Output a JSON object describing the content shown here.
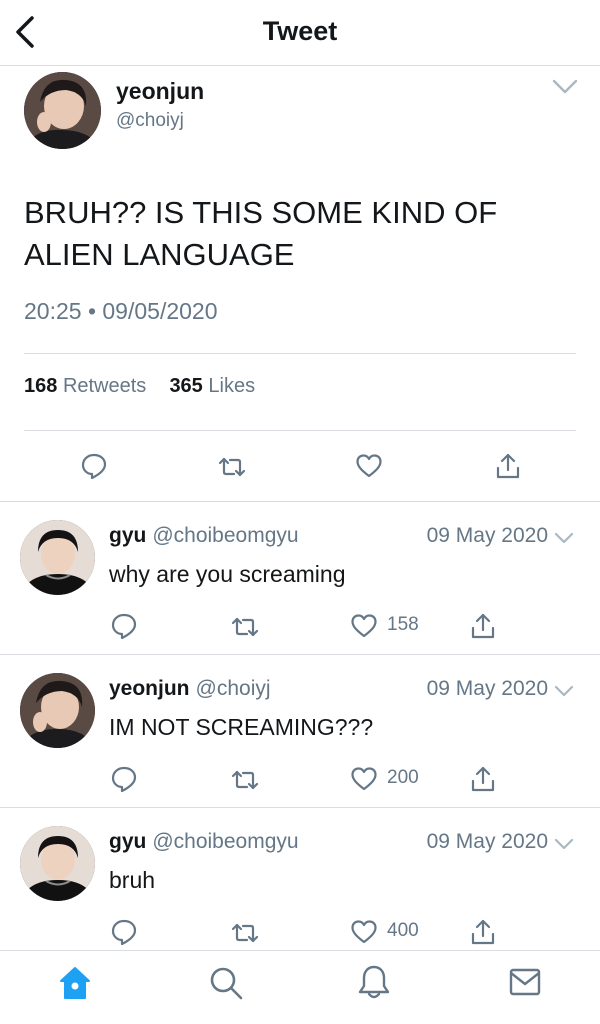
{
  "header": {
    "title": "Tweet"
  },
  "main_tweet": {
    "name": "yeonjun",
    "handle": "@choiyj",
    "text": "BRUH?? IS THIS SOME KIND OF ALIEN LANGUAGE",
    "timestamp": "20:25 • 09/05/2020",
    "retweets_count": "168",
    "retweets_label": "Retweets",
    "likes_count": "365",
    "likes_label": "Likes"
  },
  "replies": [
    {
      "name": "gyu",
      "handle": "@choibeomgyu",
      "date": "09 May 2020",
      "text": "why are you screaming",
      "likes": "158"
    },
    {
      "name": "yeonjun",
      "handle": "@choiyj",
      "date": "09 May 2020",
      "text": "IM NOT SCREAMING???",
      "likes": "200"
    },
    {
      "name": "gyu",
      "handle": "@choibeomgyu",
      "date": "09 May 2020",
      "text": "bruh",
      "likes": "400"
    }
  ],
  "colors": {
    "accent": "#1da1f2",
    "muted": "#657786",
    "text": "#14171a",
    "divider": "#d9dde1"
  },
  "icons": {
    "header": [
      "back-icon"
    ],
    "actions": [
      "reply-icon",
      "retweet-icon",
      "like-icon",
      "share-icon"
    ],
    "nav": [
      "home-icon",
      "search-icon",
      "notifications-icon",
      "messages-icon"
    ]
  }
}
